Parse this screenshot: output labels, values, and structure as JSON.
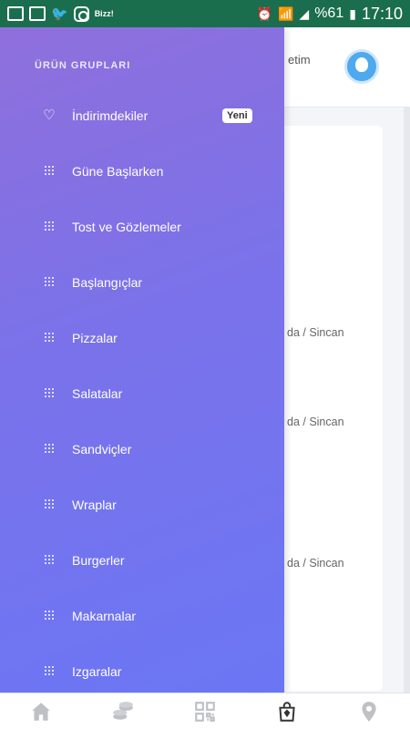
{
  "statusbar": {
    "notification_icons": [
      "mail-icon",
      "image-icon",
      "twitter-icon",
      "instagram-icon"
    ],
    "bizz_label": "Bizz!",
    "battery": "%61",
    "time": "17:10"
  },
  "background": {
    "header_text": "etim",
    "locations": [
      "da / Sincan",
      "da / Sincan",
      "da / Sincan"
    ]
  },
  "drawer": {
    "title": "ÜRÜN GRUPLARI",
    "items": [
      {
        "label": "İndirimdekiler",
        "icon": "heart-icon",
        "badge": "Yeni"
      },
      {
        "label": "Güne Başlarken",
        "icon": "grid-dots-icon"
      },
      {
        "label": "Tost ve Gözlemeler",
        "icon": "grid-dots-icon"
      },
      {
        "label": "Başlangıçlar",
        "icon": "grid-dots-icon"
      },
      {
        "label": "Pizzalar",
        "icon": "grid-dots-icon"
      },
      {
        "label": "Salatalar",
        "icon": "grid-dots-icon"
      },
      {
        "label": "Sandviçler",
        "icon": "grid-dots-icon"
      },
      {
        "label": "Wraplar",
        "icon": "grid-dots-icon"
      },
      {
        "label": "Burgerler",
        "icon": "grid-dots-icon"
      },
      {
        "label": "Makarnalar",
        "icon": "grid-dots-icon"
      },
      {
        "label": "Izgaralar",
        "icon": "grid-dots-icon"
      }
    ]
  },
  "bottom_nav": [
    "home-icon",
    "coins-icon",
    "qr-code-icon",
    "shopping-bag-icon",
    "location-pin-icon"
  ],
  "colors": {
    "statusbar": "#1b6e4d",
    "drawer_top": "#8f6fdc",
    "drawer_bottom": "#6b76f4",
    "nav_icon": "#bfc0c6",
    "nav_active": "#333333"
  }
}
